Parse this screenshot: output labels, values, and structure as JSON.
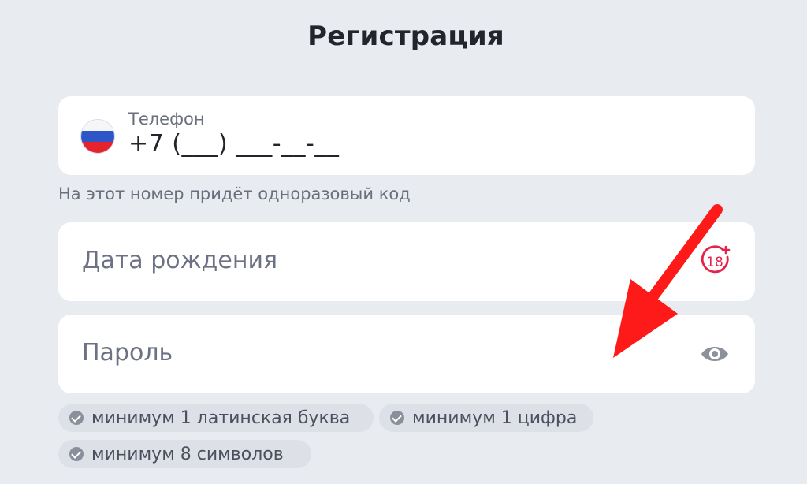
{
  "title": "Регистрация",
  "phone": {
    "label": "Телефон",
    "value": "+7 (___) ___-__-__",
    "flag_icon": "russia-flag-icon"
  },
  "phone_hint": "На этот номер придёт одноразовый код",
  "birth_date": {
    "placeholder": "Дата рождения",
    "icon": "age-18-plus-icon",
    "icon_text": "18",
    "accent_color": "#e5234a"
  },
  "password": {
    "placeholder": "Пароль",
    "icon": "eye-icon"
  },
  "requirements": [
    {
      "label": "минимум 1 латинская буква",
      "icon": "check-circle-icon"
    },
    {
      "label": "минимум 1 цифра",
      "icon": "check-circle-icon"
    },
    {
      "label": "минимум 8 символов",
      "icon": "check-circle-icon"
    }
  ],
  "annotation": {
    "icon": "red-arrow-annotation",
    "color": "#ff1a1a"
  }
}
